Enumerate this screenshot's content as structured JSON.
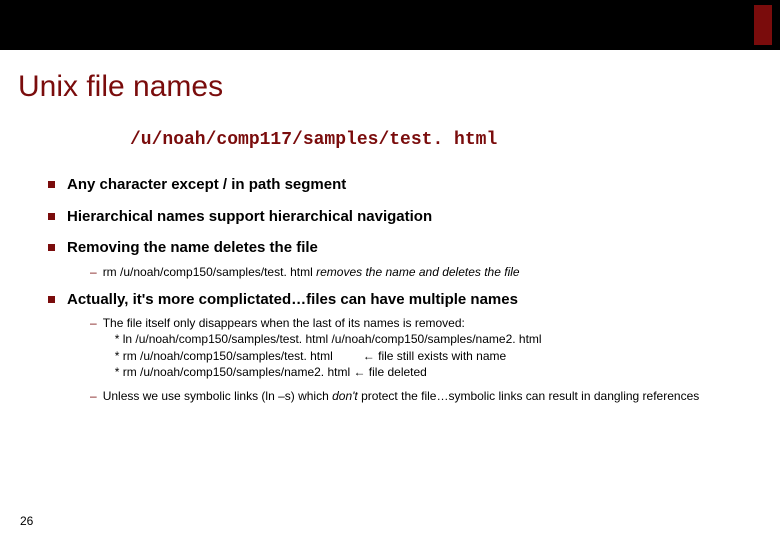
{
  "title": "Unix file names",
  "filepath": "/u/noah/comp117/samples/test. html",
  "bullets": {
    "b1": "Any character except / in path segment",
    "b2": "Hierarchical names support hierarchical navigation",
    "b3": "Removing the name deletes the file",
    "b3_sub_cmd": "rm /u/noah/comp150/samples/test. html  ",
    "b3_sub_note": "removes the name and deletes the file",
    "b4": "Actually, it's more complictated…files can have multiple names",
    "b4_sub1_intro": "The file itself only disappears when the last of its names is removed:",
    "b4_sub1_l1": "* ln /u/noah/comp150/samples/test. html /u/noah/comp150/samples/name2. html",
    "b4_sub1_l2a": "* rm /u/noah/comp150/samples/test. html",
    "b4_sub1_l2b": " ← file still exists with name",
    "b4_sub1_l3a": "* rm /u/noah/comp150/samples/name2. html",
    "b4_sub1_l3b": " ← file deleted",
    "b4_sub2_a": "Unless we use symbolic links (ln –s) which ",
    "b4_sub2_b": "don't",
    "b4_sub2_c": " protect the file…symbolic links can result in dangling references"
  },
  "page_number": "26"
}
